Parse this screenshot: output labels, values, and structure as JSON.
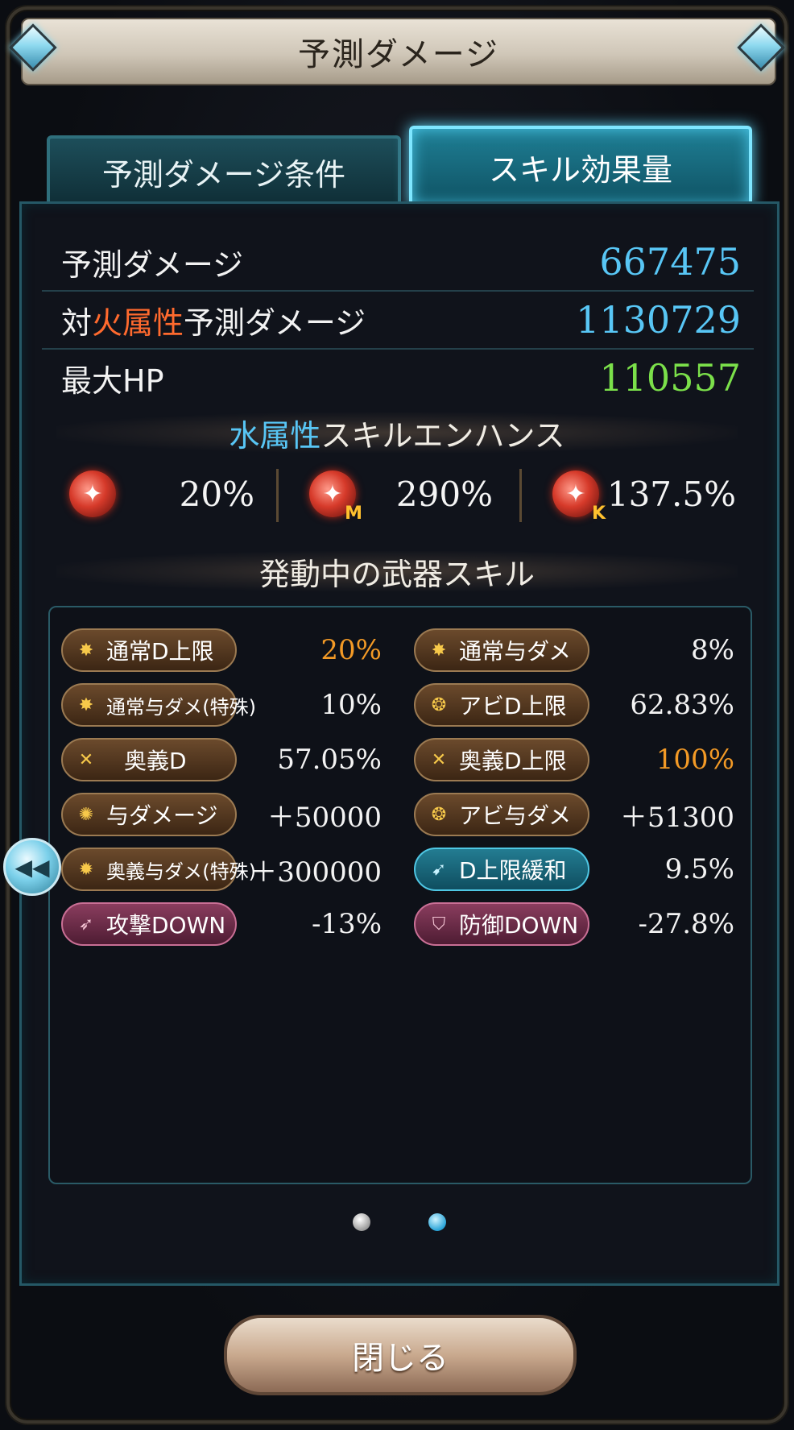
{
  "header": {
    "title": "予測ダメージ"
  },
  "tabs": [
    {
      "label": "予測ダメージ条件",
      "active": false
    },
    {
      "label": "スキル効果量",
      "active": true
    }
  ],
  "summary": {
    "predicted_label": "予測ダメージ",
    "predicted_value": "667475",
    "vs_prefix": "対",
    "vs_element": "火属性",
    "vs_suffix": "予測ダメージ",
    "vs_value": "1130729",
    "maxhp_label": "最大HP",
    "maxhp_value": "110557"
  },
  "enhance": {
    "element": "水属性",
    "title_suffix": "スキルエンハンス",
    "items": [
      {
        "icon": "normal-skill-icon",
        "sub": "",
        "value": "20%"
      },
      {
        "icon": "magna-skill-icon",
        "sub": "M",
        "value": "290%"
      },
      {
        "icon": "ex-skill-icon",
        "sub": "K",
        "value": "137.5%"
      }
    ]
  },
  "weapon_skills": {
    "title": "発動中の武器スキル",
    "left": [
      {
        "label": "通常D上限",
        "value": "20%",
        "highlight": true
      },
      {
        "label": "通常与ダメ(特殊)",
        "value": "10%"
      },
      {
        "label": "奥義D",
        "value": "57.05%"
      },
      {
        "label": "与ダメージ",
        "value": "＋50000"
      },
      {
        "label": "奥義与ダメ(特殊)",
        "value": "＋300000"
      },
      {
        "label": "攻撃DOWN",
        "value": "-13%"
      }
    ],
    "right": [
      {
        "label": "通常与ダメ",
        "value": "8%"
      },
      {
        "label": "アビD上限",
        "value": "62.83%"
      },
      {
        "label": "奥義D上限",
        "value": "100%",
        "highlight": true
      },
      {
        "label": "アビ与ダメ",
        "value": "＋51300"
      },
      {
        "label": "D上限緩和",
        "value": "9.5%"
      },
      {
        "label": "防御DOWN",
        "value": "-27.8%"
      }
    ]
  },
  "pager": {
    "pages": 2,
    "current": 2
  },
  "footer": {
    "close_label": "閉じる"
  },
  "colors": {
    "fire": "#ff6a2e",
    "water": "#58c6f5",
    "hp": "#7be04a",
    "highlight": "#f39a26"
  }
}
